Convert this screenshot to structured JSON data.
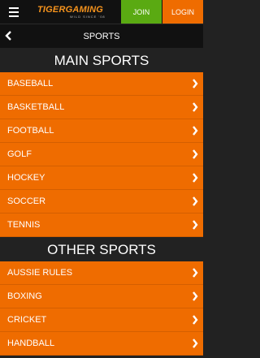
{
  "topbar": {
    "logo_main": "TIGERGAMING",
    "logo_sub": "WILD SINCE '08",
    "join_label": "JOIN",
    "login_label": "LOGIN"
  },
  "titlebar": {
    "title": "SPORTS"
  },
  "main_sports": {
    "header": "MAIN SPORTS",
    "items": [
      {
        "label": "BASEBALL"
      },
      {
        "label": "BASKETBALL"
      },
      {
        "label": "FOOTBALL"
      },
      {
        "label": "GOLF"
      },
      {
        "label": "HOCKEY"
      },
      {
        "label": "SOCCER"
      },
      {
        "label": "TENNIS"
      }
    ]
  },
  "other_sports": {
    "header": "OTHER SPORTS",
    "items": [
      {
        "label": "AUSSIE RULES"
      },
      {
        "label": "BOXING"
      },
      {
        "label": "CRICKET"
      },
      {
        "label": "HANDBALL"
      }
    ]
  },
  "colors": {
    "accent": "#ef6c00",
    "join": "#5aaa12",
    "background": "#222222"
  }
}
